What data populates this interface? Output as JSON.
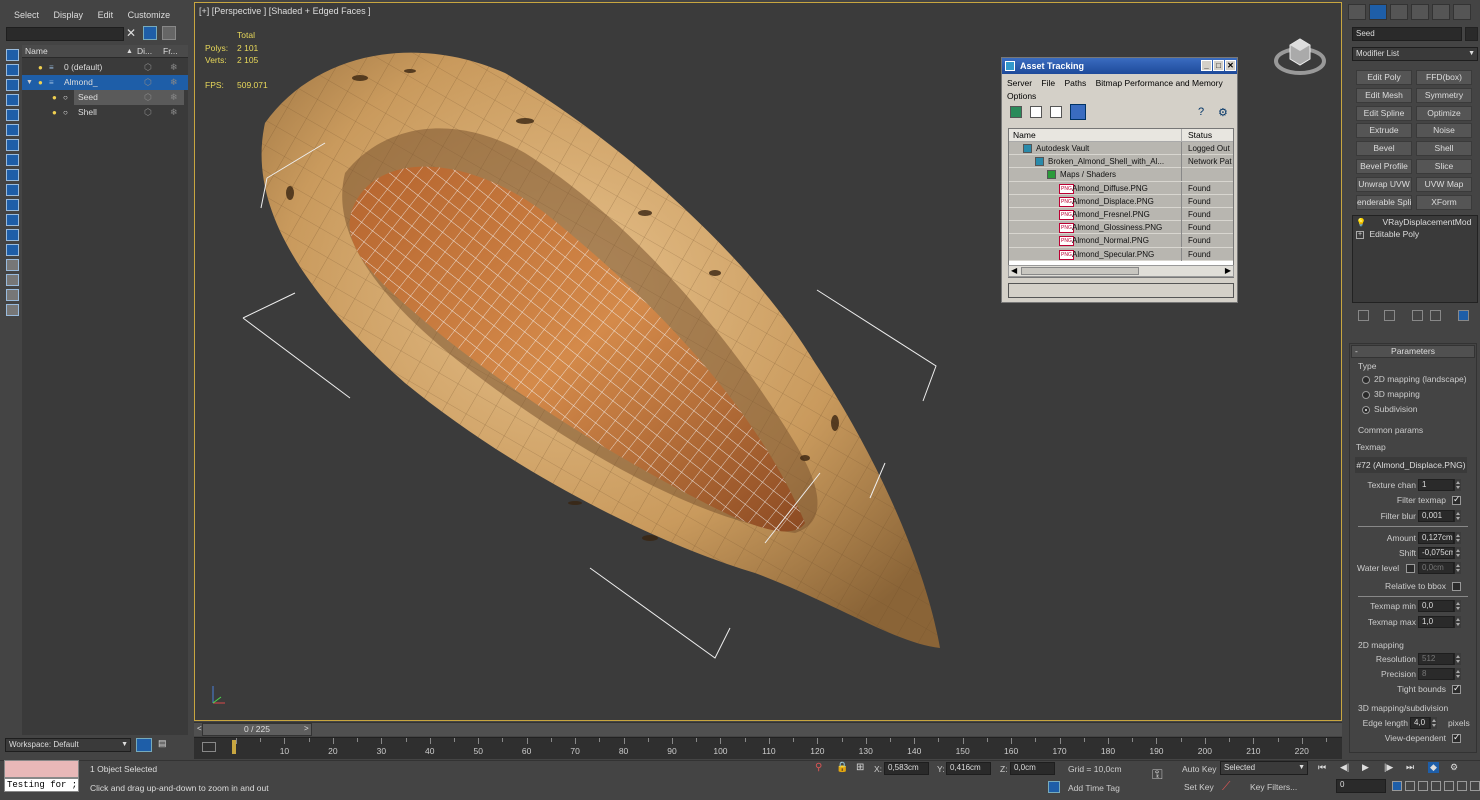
{
  "scene_explorer": {
    "menus": [
      "Select",
      "Display",
      "Edit",
      "Customize"
    ],
    "columns": [
      "Name",
      "Di...",
      "Fr..."
    ],
    "rows": [
      {
        "label": "0 (default)",
        "indent": 0,
        "selected": false
      },
      {
        "label": "Almond_",
        "indent": 0,
        "selected": true
      },
      {
        "label": "Seed",
        "indent": 1,
        "selected": false
      },
      {
        "label": "Shell",
        "indent": 1,
        "selected": false
      }
    ],
    "workspace_label": "Workspace: Default"
  },
  "viewport": {
    "label": "[+] [Perspective ] [Shaded + Edged Faces ]",
    "stats_header": "Total",
    "polys_label": "Polys:",
    "polys_value": "2 101",
    "verts_label": "Verts:",
    "verts_value": "2 105",
    "fps_label": "FPS:",
    "fps_value": "509.071"
  },
  "asset_tracking": {
    "title": "Asset Tracking",
    "menus": [
      "Server",
      "File",
      "Paths",
      "Bitmap Performance and Memory"
    ],
    "menu_row2": "Options",
    "columns": [
      "Name",
      "Status"
    ],
    "rows": [
      {
        "name": "Autodesk Vault",
        "status": "Logged Out",
        "indent": 1,
        "icon": "vault-icon"
      },
      {
        "name": "Broken_Almond_Shell_with_Al...",
        "status": "Network Pat",
        "indent": 2,
        "icon": "max-file-icon"
      },
      {
        "name": "Maps / Shaders",
        "status": "",
        "indent": 3,
        "icon": "maps-icon"
      },
      {
        "name": "Almond_Diffuse.PNG",
        "status": "Found",
        "indent": 4,
        "icon": "png-icon"
      },
      {
        "name": "Almond_Displace.PNG",
        "status": "Found",
        "indent": 4,
        "icon": "png-icon"
      },
      {
        "name": "Almond_Fresnel.PNG",
        "status": "Found",
        "indent": 4,
        "icon": "png-icon"
      },
      {
        "name": "Almond_Glossiness.PNG",
        "status": "Found",
        "indent": 4,
        "icon": "png-icon"
      },
      {
        "name": "Almond_Normal.PNG",
        "status": "Found",
        "indent": 4,
        "icon": "png-icon"
      },
      {
        "name": "Almond_Specular.PNG",
        "status": "Found",
        "indent": 4,
        "icon": "png-icon"
      }
    ],
    "png_badge": "PNG"
  },
  "command_panel": {
    "object_name": "Seed",
    "modifier_list": "Modifier List",
    "buttons": [
      [
        "Edit Poly",
        "FFD(box)"
      ],
      [
        "Edit Mesh",
        "Symmetry"
      ],
      [
        "Edit Spline",
        "Optimize"
      ],
      [
        "Extrude",
        "Noise"
      ],
      [
        "Bevel",
        "Shell"
      ],
      [
        "Bevel Profile",
        "Slice"
      ],
      [
        "Unwrap UVW",
        "UVW Map"
      ],
      [
        "enderable Splin",
        "XForm"
      ]
    ],
    "stack": [
      "VRayDisplacementMod",
      "Editable Poly"
    ],
    "parameters_title": "Parameters",
    "type_group": "Type",
    "type_options": [
      {
        "label": "2D mapping (landscape)",
        "on": false
      },
      {
        "label": "3D mapping",
        "on": false
      },
      {
        "label": "Subdivision",
        "on": true
      }
    ],
    "common_group": "Common params",
    "texmap_label": "Texmap",
    "texmap_value": "#72 (Almond_Displace.PNG)",
    "texture_chan_label": "Texture chan",
    "texture_chan_value": "1",
    "filter_texmap_label": "Filter texmap",
    "filter_blur_label": "Filter blur",
    "filter_blur_value": "0,001",
    "amount_label": "Amount",
    "amount_value": "0,127cm",
    "shift_label": "Shift",
    "shift_value": "-0,075cm",
    "water_label": "Water level",
    "water_value": "0,0cm",
    "relative_label": "Relative to bbox",
    "texmap_min_label": "Texmap min",
    "texmap_min_value": "0,0",
    "texmap_max_label": "Texmap max",
    "texmap_max_value": "1,0",
    "mapping2d_group": "2D mapping",
    "resolution_label": "Resolution",
    "resolution_value": "512",
    "precision_label": "Precision",
    "precision_value": "8",
    "tight_label": "Tight bounds",
    "mapping3d_group": "3D mapping/subdivision",
    "edge_label": "Edge length",
    "edge_value": "4,0",
    "pixels_label": "pixels",
    "viewdep_label": "View-dependent"
  },
  "timeline": {
    "frame_label": "0 / 225",
    "ticks": [
      "10",
      "20",
      "30",
      "40",
      "50",
      "60",
      "70",
      "80",
      "90",
      "100",
      "110",
      "120",
      "130",
      "140",
      "150",
      "160",
      "170",
      "180",
      "190",
      "200",
      "210",
      "220"
    ]
  },
  "status": {
    "maxscript": "Testing for ;",
    "selection": "1 Object Selected",
    "prompt": "Click and drag up-and-down to zoom in and out",
    "x_label": "X:",
    "x_value": "0,583cm",
    "y_label": "Y:",
    "y_value": "0,416cm",
    "z_label": "Z:",
    "z_value": "0,0cm",
    "grid": "Grid = 10,0cm",
    "add_time_tag": "Add Time Tag",
    "auto_key": "Auto Key",
    "set_key": "Set Key",
    "selected": "Selected",
    "key_filters": "Key Filters...",
    "frame_value": "0"
  },
  "colors": {
    "accent": "#1e5ea8",
    "viewport_bg": "#3d3d3d",
    "timeline_bg": "#2f2f2f"
  }
}
